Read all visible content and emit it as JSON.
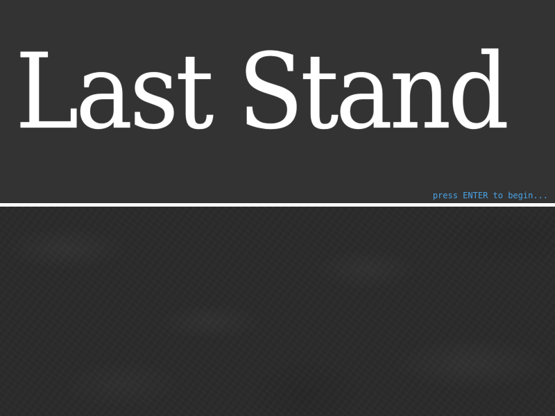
{
  "title_screen": {
    "title": "Last Stand",
    "prompt": "press ENTER to begin...",
    "colors": {
      "background_top": "#333333",
      "background_bottom": "#2a2a2a",
      "title_text": "#ffffff",
      "divider": "#ffffff",
      "prompt_text": "#4aa3e6"
    }
  }
}
